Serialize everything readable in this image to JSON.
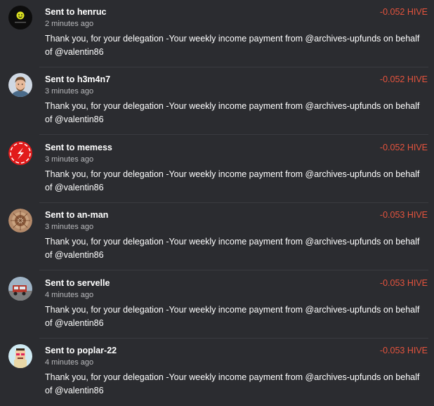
{
  "transfers": [
    {
      "headline": "Sent to henruc",
      "time": "2 minutes ago",
      "amount": "-0.052 HIVE",
      "memo": "Thank you, for your delegation -Your weekly income payment from @archives-upfunds on behalf of @valentin86"
    },
    {
      "headline": "Sent to h3m4n7",
      "time": "3 minutes ago",
      "amount": "-0.052 HIVE",
      "memo": "Thank you, for your delegation -Your weekly income payment from @archives-upfunds on behalf of @valentin86"
    },
    {
      "headline": "Sent to memess",
      "time": "3 minutes ago",
      "amount": "-0.052 HIVE",
      "memo": "Thank you, for your delegation -Your weekly income payment from @archives-upfunds on behalf of @valentin86"
    },
    {
      "headline": "Sent to an-man",
      "time": "3 minutes ago",
      "amount": "-0.053 HIVE",
      "memo": "Thank you, for your delegation -Your weekly income payment from @archives-upfunds on behalf of @valentin86"
    },
    {
      "headline": "Sent to servelle",
      "time": "4 minutes ago",
      "amount": "-0.053 HIVE",
      "memo": "Thank you, for your delegation -Your weekly income payment from @archives-upfunds on behalf of @valentin86"
    },
    {
      "headline": "Sent to poplar-22",
      "time": "4 minutes ago",
      "amount": "-0.053 HIVE",
      "memo": "Thank you, for your delegation -Your weekly income payment from @archives-upfunds on behalf of @valentin86"
    }
  ],
  "colors": {
    "background": "#2b2c30",
    "amount_negative": "#e5533d",
    "muted_text": "#b9babd"
  }
}
